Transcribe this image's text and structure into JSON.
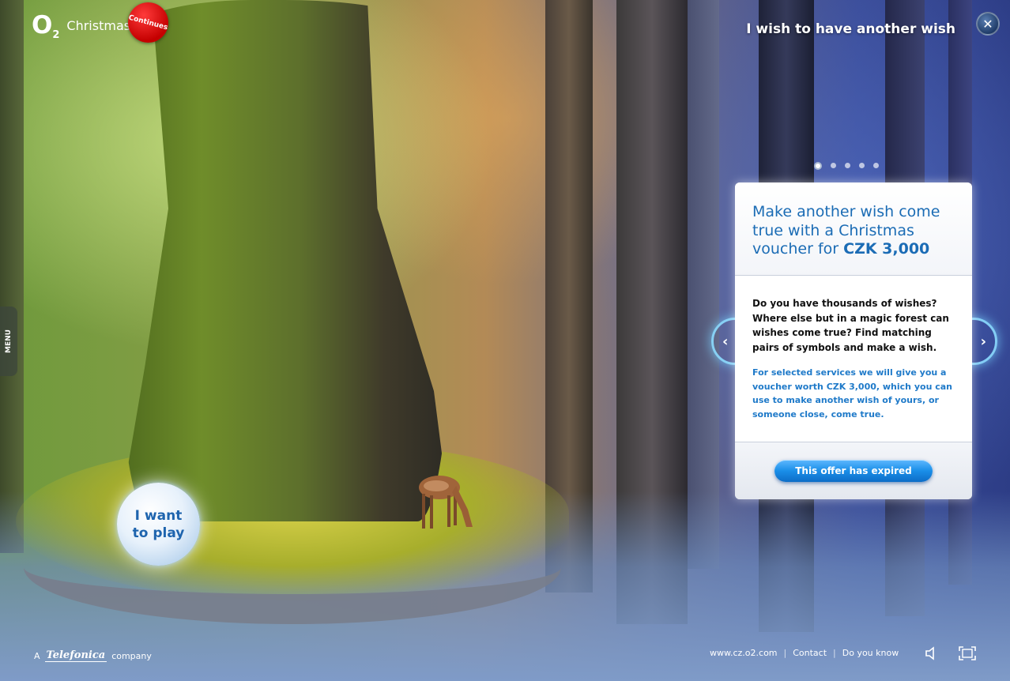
{
  "header": {
    "logo_o": "O",
    "logo_two": "2",
    "logo_word": "Christmas",
    "badge": "Continues",
    "title": "I wish to have another wish"
  },
  "menu": {
    "label": "MENU"
  },
  "pagination": {
    "count": 5,
    "active_index": 0
  },
  "card": {
    "heading_prefix": "Make another wish come true with a Christmas voucher for",
    "heading_amount": "CZK 3,000",
    "lead": "Do you have thousands of wishes? Where else but in a magic forest can wishes come true? Find matching pairs of symbols and make a wish.",
    "note": "For selected services we will give you a voucher worth CZK 3,000, which you can use to make another wish of yours, or someone close, come true.",
    "button_label": "This offer has expired"
  },
  "play": {
    "label": "I want to play"
  },
  "footer": {
    "prefix": "A",
    "brand": "Telefonica",
    "suffix": "company",
    "links": [
      "www.cz.o2.com",
      "Contact",
      "Do you know"
    ]
  },
  "colors": {
    "accent_blue": "#1b6cb5",
    "button_blue": "#1a8ee8",
    "badge_red": "#c40000"
  },
  "icons": {
    "close": "close-icon",
    "prev": "chevron-left-icon",
    "next": "chevron-right-icon",
    "sound": "speaker-icon",
    "fullscreen": "fullscreen-icon"
  }
}
